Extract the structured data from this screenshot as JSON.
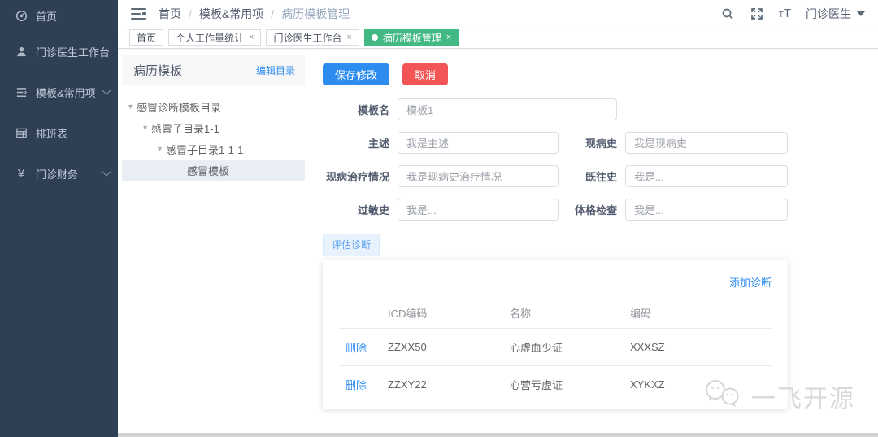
{
  "colors": {
    "primary": "#2d8cf0",
    "danger": "#f25555",
    "tab_active_green": "#42b983",
    "sidebar_bg": "#2f3f54"
  },
  "sidebar": {
    "items": [
      {
        "label": "首页",
        "icon": "dashboard-icon",
        "expandable": false
      },
      {
        "label": "门诊医生工作台",
        "icon": "doctor-workbench-icon",
        "expandable": false
      },
      {
        "label": "模板&常用项",
        "icon": "template-icon",
        "expandable": true
      },
      {
        "label": "排班表",
        "icon": "schedule-icon",
        "expandable": false
      },
      {
        "label": "门诊财务",
        "icon": "finance-icon",
        "expandable": true,
        "icon_char": "¥"
      }
    ]
  },
  "header": {
    "breadcrumb": [
      "首页",
      "模板&常用项",
      "病历模板管理"
    ],
    "font_size_icon_text": "T",
    "user": "门诊医生"
  },
  "tabs": [
    {
      "label": "首页",
      "closable": false,
      "active": false
    },
    {
      "label": "个人工作量统计",
      "closable": true,
      "active": false
    },
    {
      "label": "门诊医生工作台",
      "closable": true,
      "active": false
    },
    {
      "label": "病历模板管理",
      "closable": true,
      "active": true
    }
  ],
  "icons": {
    "close_glyph": "×"
  },
  "panel": {
    "title": "病历模板",
    "edit_link": "编辑目录",
    "tree": [
      {
        "label": "感冒诊断模板目录",
        "depth": 0,
        "selected": false
      },
      {
        "label": "感冒子目录1-1",
        "depth": 1,
        "selected": false
      },
      {
        "label": "感冒子目录1-1-1",
        "depth": 2,
        "selected": false
      },
      {
        "label": "感冒模板",
        "depth": 3,
        "selected": true
      }
    ]
  },
  "form": {
    "save_label": "保存修改",
    "cancel_label": "取消",
    "fields": [
      {
        "label": "模板名",
        "value": "模板1"
      },
      {
        "label": "主述",
        "value": "我是主述"
      },
      {
        "label": "现病史",
        "value": "我是现病史"
      },
      {
        "label": "现病治疗情况",
        "value": "我是现病史治疗情况"
      },
      {
        "label": "既往史",
        "value": "我是..."
      },
      {
        "label": "过敏史",
        "value": "我是..."
      },
      {
        "label": "体格检查",
        "value": "我是..."
      }
    ]
  },
  "diagnosis": {
    "tab_label": "评估诊断",
    "add_link": "添加诊断",
    "action_label": "删除",
    "columns": [
      "ICD编码",
      "名称",
      "编码"
    ],
    "rows": [
      [
        "ZZXX50",
        "心虚血少证",
        "XXXSZ"
      ],
      [
        "ZZXY22",
        "心营亏虚证",
        "XYKXZ"
      ]
    ]
  },
  "watermark": "一飞开源"
}
